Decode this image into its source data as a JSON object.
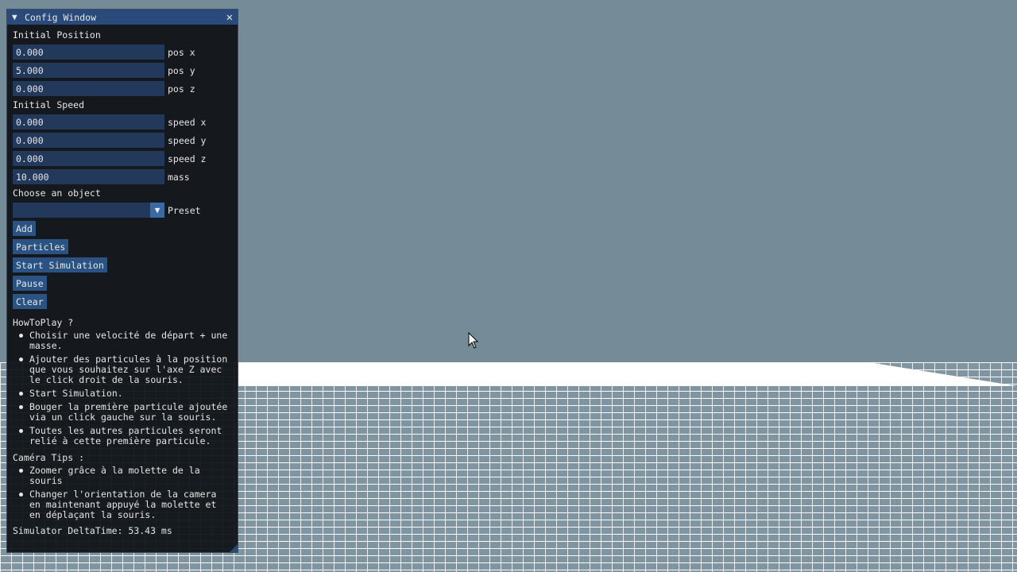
{
  "window": {
    "title": "Config Window",
    "close_glyph": "✕",
    "collapse_glyph": "▼"
  },
  "initial_position": {
    "label": "Initial Position",
    "fields": [
      {
        "value": "0.000",
        "label": "pos x"
      },
      {
        "value": "5.000",
        "label": "pos y"
      },
      {
        "value": "0.000",
        "label": "pos z"
      }
    ]
  },
  "initial_speed": {
    "label": "Initial Speed",
    "fields": [
      {
        "value": "0.000",
        "label": "speed x"
      },
      {
        "value": "0.000",
        "label": "speed y"
      },
      {
        "value": "0.000",
        "label": "speed z"
      }
    ]
  },
  "mass": {
    "value": "10.000",
    "label": "mass"
  },
  "object_choice": {
    "label": "Choose an object",
    "selected": "",
    "combo_label": "Preset",
    "arrow_glyph": "▼"
  },
  "buttons": {
    "add": "Add",
    "particles": "Particles",
    "start": "Start Simulation",
    "pause": "Pause",
    "clear": "Clear"
  },
  "how_to_play": {
    "title": "HowToPlay ?",
    "items": [
      "Choisir une velocité de départ + une\nmasse.",
      "Ajouter des particules à la position\nque vous souhaitez sur l'axe Z avec\nle click droit de la souris.",
      "Start Simulation.",
      "Bouger la première particule ajoutée\nvia un click gauche sur la souris.",
      "Toutes les autres particules seront\nrelié à cette première particule."
    ]
  },
  "camera_tips": {
    "title": "Caméra Tips :",
    "items": [
      "Zoomer grâce à la molette de la\nsouris",
      "Changer l'orientation de la camera\nen maintenant appuyé la molette et\nen déplaçant la souris."
    ]
  },
  "status": {
    "delta_time": "Simulator DeltaTime: 53.43 ms"
  },
  "colors": {
    "sky": "#758b98",
    "panel_bg": "#0f1216",
    "titlebar": "#294a7a",
    "field_bg": "#23395c",
    "button_bg": "#2a5383"
  },
  "icons": {
    "cursor": "mouse-pointer-icon"
  }
}
